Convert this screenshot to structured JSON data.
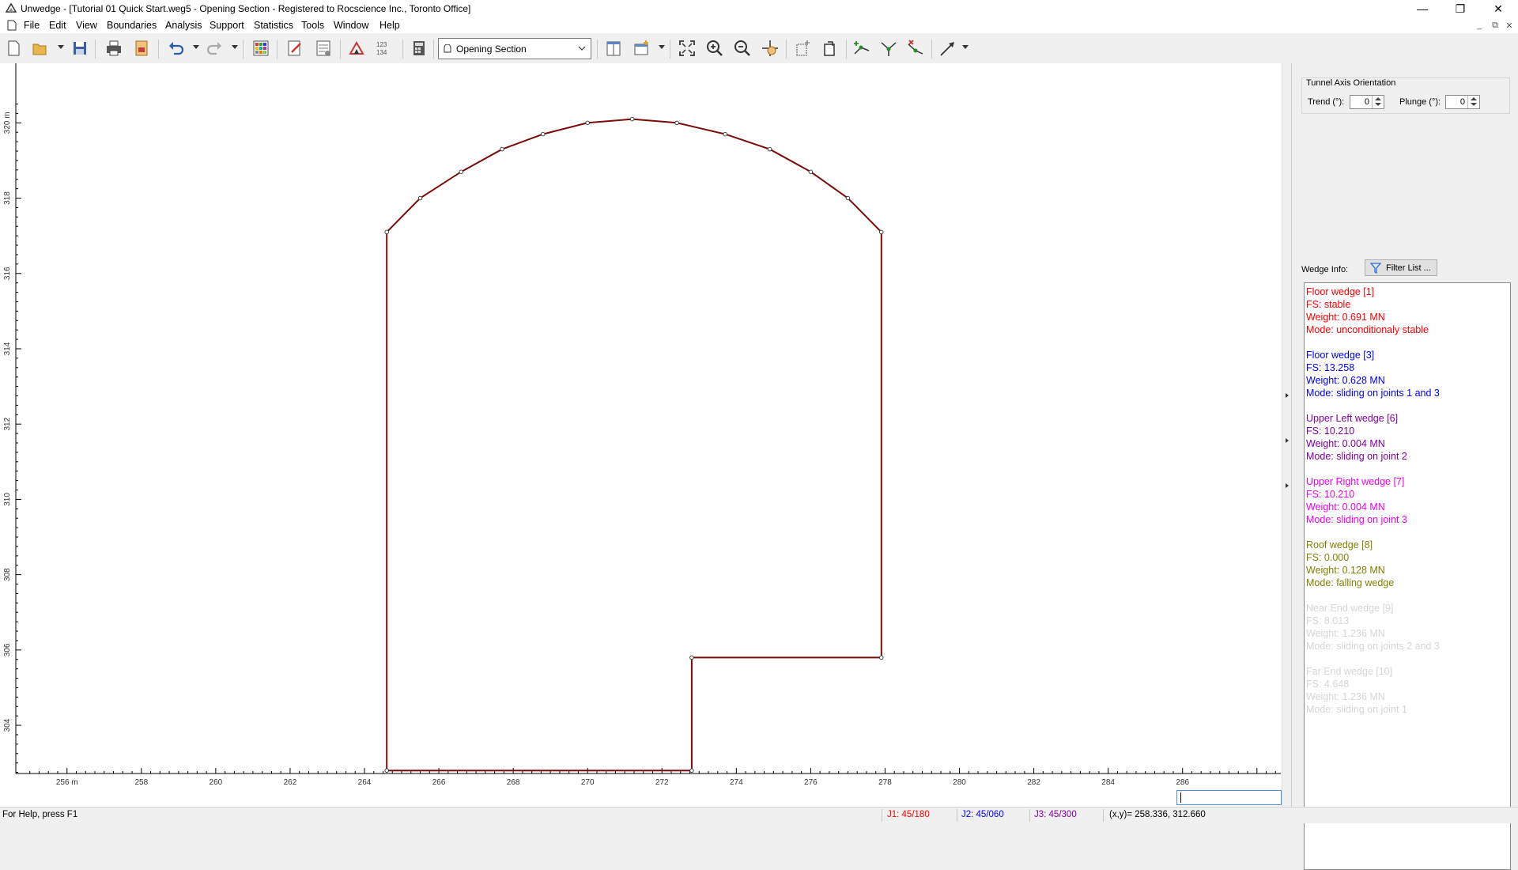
{
  "window": {
    "title": "Unwedge - [Tutorial 01 Quick Start.weg5 - Opening Section - Registered to Rocscience Inc., Toronto Office]",
    "controls": {
      "minimize": "—",
      "restore": "❐",
      "close": "✕"
    }
  },
  "menu": {
    "items": [
      "File",
      "Edit",
      "View",
      "Boundaries",
      "Analysis",
      "Support",
      "Statistics",
      "Tools",
      "Window",
      "Help"
    ],
    "mdi_controls": [
      "_",
      "⧉",
      "✕"
    ]
  },
  "toolbar": {
    "view_select": "Opening Section"
  },
  "canvas": {
    "x_axis_unit": "m",
    "y_axis_unit": "m",
    "x_range": [
      254.9,
      288.6
    ],
    "y_range": [
      302.3,
      320.7
    ],
    "x_ticks": [
      256,
      258,
      260,
      262,
      264,
      266,
      268,
      270,
      272,
      274,
      276,
      278,
      280,
      282,
      284,
      286
    ],
    "y_ticks": [
      304,
      306,
      308,
      310,
      312,
      314,
      316,
      318,
      320
    ],
    "x_label_first": "256 m",
    "y_label_last": "320 m",
    "opening_vertices": [
      [
        264.6,
        302.8
      ],
      [
        272.8,
        302.8
      ],
      [
        272.8,
        305.8
      ],
      [
        277.9,
        305.8
      ],
      [
        277.9,
        317.1
      ],
      [
        277.0,
        318.0
      ],
      [
        276.0,
        318.7
      ],
      [
        274.9,
        319.3
      ],
      [
        273.7,
        319.7
      ],
      [
        272.4,
        320.0
      ],
      [
        271.2,
        320.1
      ],
      [
        270.0,
        320.0
      ],
      [
        268.8,
        319.7
      ],
      [
        267.7,
        319.3
      ],
      [
        266.6,
        318.7
      ],
      [
        265.5,
        318.0
      ],
      [
        264.6,
        317.1
      ]
    ],
    "line_color": "#7b0c0c"
  },
  "panel": {
    "tunnel_axis_title": "Tunnel Axis Orientation",
    "trend_label": "Trend (°):",
    "trend_value": "0",
    "plunge_label": "Plunge (°):",
    "plunge_value": "0",
    "wedge_info_label": "Wedge Info:",
    "filter_button": "Filter List ...",
    "wedges": [
      {
        "name": "Floor wedge [1]",
        "fs": "FS: stable",
        "weight": "Weight: 0.691 MN",
        "mode": "Mode: unconditionaly stable",
        "color": "#ff0000"
      },
      {
        "name": "Floor wedge [3]",
        "fs": "FS: 13.258",
        "weight": "Weight: 0.628 MN",
        "mode": "Mode: sliding on joints 1 and 3",
        "color": "#0000ff"
      },
      {
        "name": "Upper Left wedge [6]",
        "fs": "FS: 10.210",
        "weight": "Weight: 0.004 MN",
        "mode": "Mode: sliding on joint 2",
        "color": "#8000a0"
      },
      {
        "name": "Upper Right wedge [7]",
        "fs": "FS: 10.210",
        "weight": "Weight: 0.004 MN",
        "mode": "Mode: sliding on joint 3",
        "color": "#ee00ee"
      },
      {
        "name": "Roof wedge [8]",
        "fs": "FS: 0.000",
        "weight": "Weight: 0.128 MN",
        "mode": "Mode: falling wedge",
        "color": "#808000"
      },
      {
        "name": "Near End wedge [9]",
        "fs": "FS: 8.013",
        "weight": "Weight: 1.236 MN",
        "mode": "Mode: sliding on joints 2 and 3",
        "color": "#d6d6d6"
      },
      {
        "name": "Far End wedge [10]",
        "fs": "FS: 4.648",
        "weight": "Weight: 1.236 MN",
        "mode": "Mode: sliding on joint 1",
        "color": "#d6d6d6"
      }
    ]
  },
  "status": {
    "help": "For Help, press F1",
    "j1": "J1: 45/180",
    "j2": "J2: 45/060",
    "j3": "J3: 45/300",
    "coords": "(x,y)= 258.336, 312.660",
    "j1_color": "#ff0000",
    "j2_color": "#0000ff",
    "j3_color": "#8000a0"
  }
}
